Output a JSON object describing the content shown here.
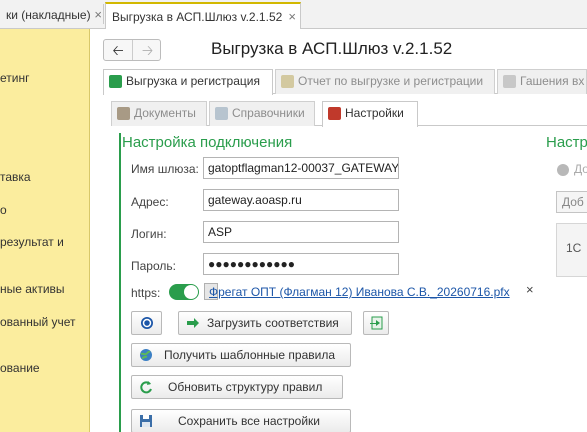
{
  "tabs": [
    {
      "label": "ки (накладные)"
    },
    {
      "label": "Выгрузка в АСП.Шлюз v.2.1.52"
    }
  ],
  "leftnav": [
    "етинг",
    "тавка",
    "о",
    "результат и",
    "ные активы",
    "ованный учет",
    "ование"
  ],
  "header": {
    "title": "Выгрузка в АСП.Шлюз v.2.1.52"
  },
  "tabs1": [
    {
      "label": "Выгрузка и регистрация"
    },
    {
      "label": "Отчет по выгрузке и регистрации"
    },
    {
      "label": "Гашения вх"
    }
  ],
  "tabs2": [
    {
      "label": "Документы"
    },
    {
      "label": "Справочники"
    },
    {
      "label": "Настройки"
    }
  ],
  "section": {
    "title": "Настройка подключения",
    "right_title": "Настр"
  },
  "fields": {
    "gateway": {
      "label": "Имя шлюза:",
      "value": "gatoptflagman12-00037_GATEWAY"
    },
    "address": {
      "label": "Адрес:",
      "value": "gateway.aoasp.ru"
    },
    "login": {
      "label": "Логин:",
      "value": "ASP"
    },
    "password": {
      "label": "Пароль:",
      "value": "●●●●●●●●●●●●"
    },
    "https": {
      "label": "https:",
      "enabled": true
    }
  },
  "cert": {
    "link": "Фрегат ОПТ (Флагман 12) Иванова С.В._20260716.pfx",
    "clear": "×"
  },
  "buttons": {
    "load_mappings": "Загрузить соответствия",
    "get_templates": "Получить шаблонные правила",
    "update_structure": "Обновить структуру правил",
    "save_all": "Сохранить все настройки"
  },
  "right": {
    "do": "До",
    "dob": "Доб",
    "onec": "1С"
  },
  "colors": {
    "accent_green": "#2a9d4c",
    "nav_yellow": "#fbed9e",
    "link_blue": "#1c56a8",
    "tab_active_border": "#d2b800",
    "settings_tab_icon": "#c0392b"
  }
}
